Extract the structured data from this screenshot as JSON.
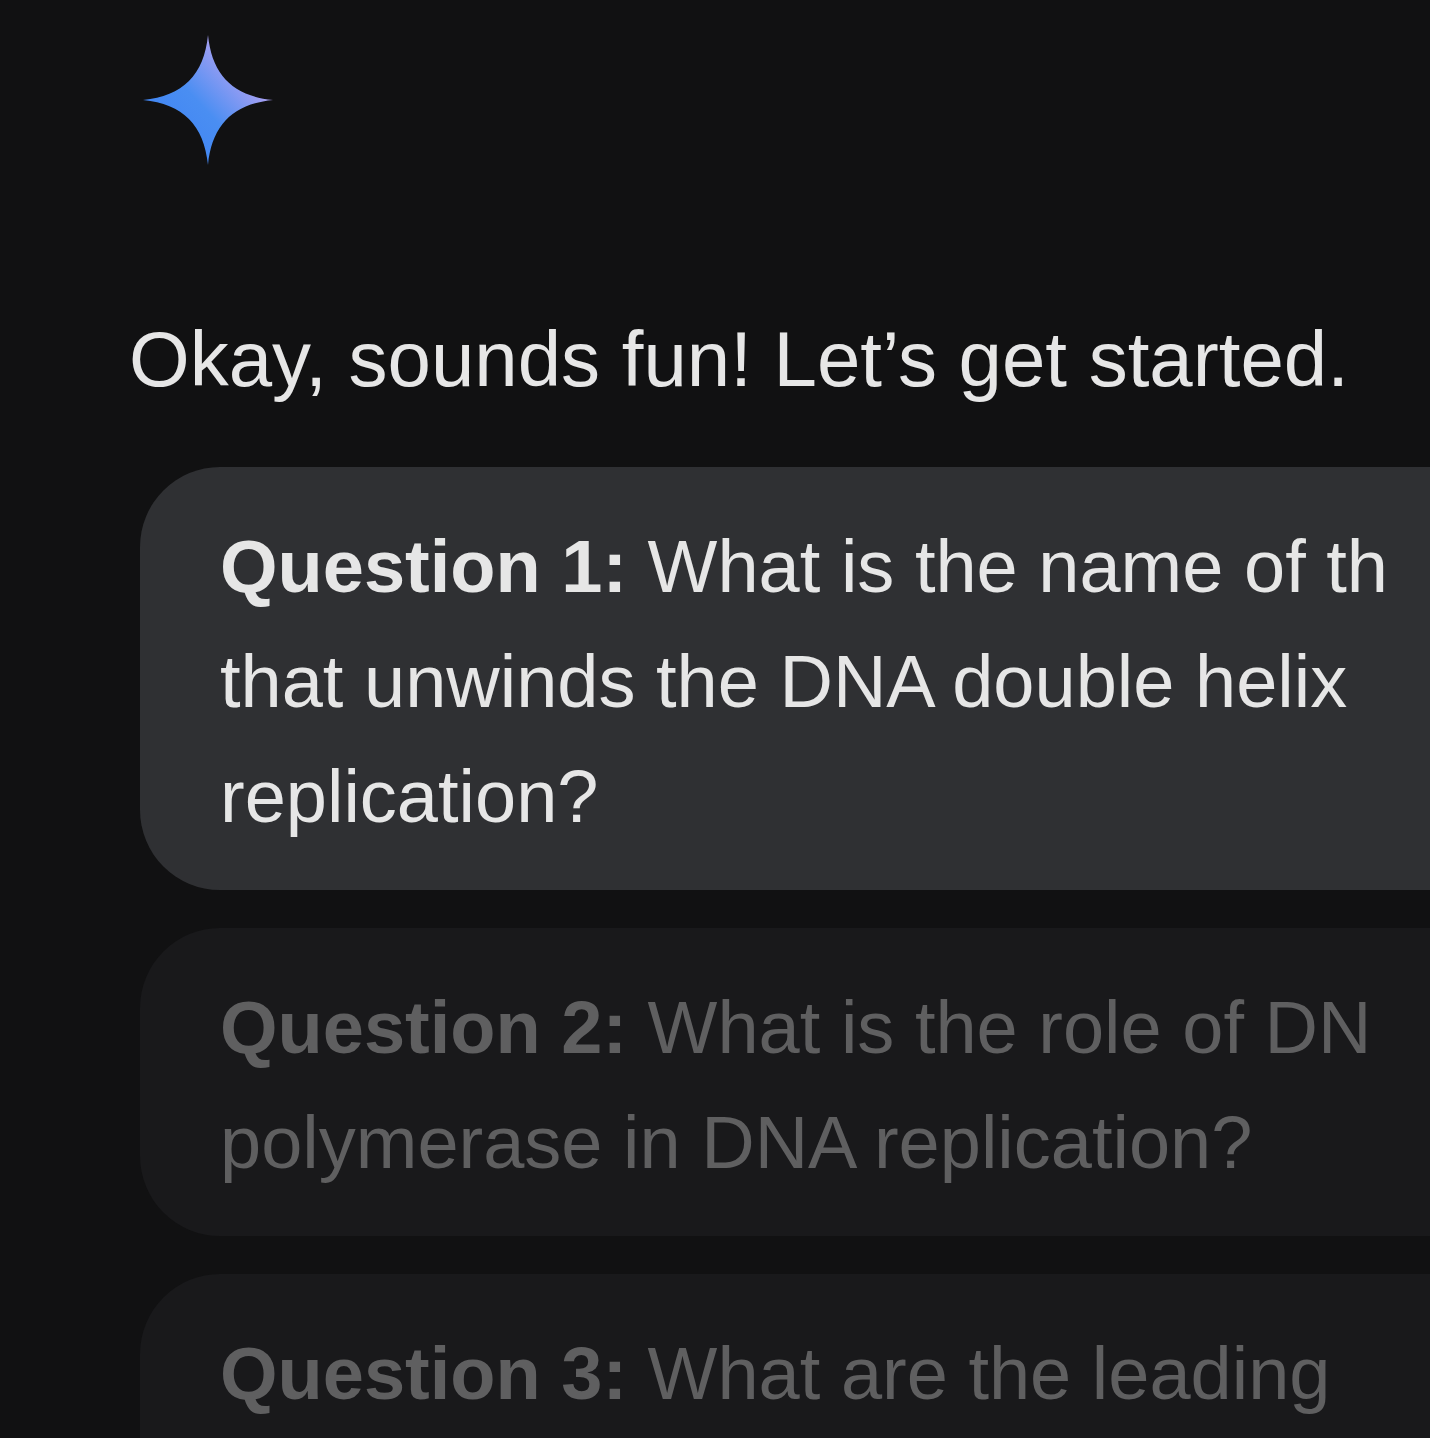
{
  "message": {
    "text": "Okay, sounds fun! Let’s get started."
  },
  "questions": [
    {
      "active": true,
      "text_lines": [
        "**Question 1:** What is the name of th",
        "that unwinds the DNA double helix",
        "replication?"
      ]
    },
    {
      "active": false,
      "text_lines": [
        "**Question 2:** What is the role of DN",
        "polymerase in DNA replication?"
      ]
    },
    {
      "active": false,
      "text_lines": [
        "**Question 3:** What are the leading"
      ]
    }
  ]
}
